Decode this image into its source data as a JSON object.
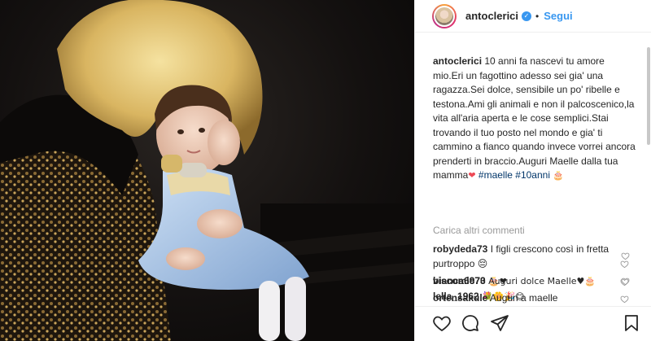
{
  "header": {
    "username": "antoclerici",
    "separator": "•",
    "follow_label": "Segui",
    "verified_glyph": "✓"
  },
  "caption": {
    "username": "antoclerici",
    "text": "10 anni fa nascevi tu amore mio.Eri un fagottino adesso sei gia' una ragazza.Sei dolce, sensibile un po' ribelle e testona.Ami gli animali e non il palcoscenico,la vita all'aria aperta e le cose semplici.Stai trovando il tuo posto nel mondo e gia' ti cammino a fianco quando invece vorrei ancora prenderti in braccio.Auguri Maelle dalla tua mamma",
    "emoji_end": "❤",
    "hashtag1": "#maelle",
    "hashtag2": "#10anni",
    "emoji_tags": "🎂"
  },
  "load_more_label": "Carica altri commenti",
  "comments": [
    {
      "username": "robydeda73",
      "text": "I figli crescono così in fretta purtroppo 😔"
    },
    {
      "username": "viscomic73",
      "text": "🎂❤"
    },
    {
      "username": "lella_1962",
      "text": "💐🌼🎉😊"
    },
    {
      "username": "bianca6970",
      "text": "Auguri dolce Maelle♥🎂"
    },
    {
      "username": "ortensakule",
      "text": "Auguri a maelle"
    }
  ],
  "icons": {
    "like": "heart-icon",
    "comment": "comment-icon",
    "share": "share-icon",
    "save": "bookmark-icon",
    "comment_like": "heart-icon"
  },
  "colors": {
    "accent": "#3897f0",
    "hashtag": "#003569",
    "muted": "#999999",
    "text": "#262626",
    "heart_red": "#ed4956"
  }
}
